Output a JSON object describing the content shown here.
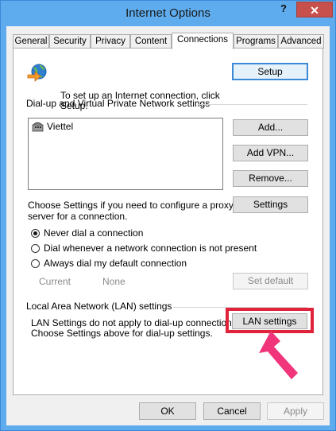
{
  "window": {
    "title": "Internet Options",
    "help_label": "?",
    "close_label": "✕"
  },
  "tabs": [
    "General",
    "Security",
    "Privacy",
    "Content",
    "Connections",
    "Programs",
    "Advanced"
  ],
  "active_tab": "Connections",
  "setup": {
    "text_line1": "To set up an Internet connection, click",
    "text_line2": "Setup.",
    "button": "Setup"
  },
  "dialup": {
    "heading": "Dial-up and Virtual Private Network settings",
    "items": [
      "Viettel"
    ],
    "add_button": "Add...",
    "add_vpn_button": "Add VPN...",
    "remove_button": "Remove...",
    "choose_text_line1": "Choose Settings if you need to configure a proxy",
    "choose_text_line2": "server for a connection.",
    "settings_button": "Settings",
    "options": [
      {
        "label": "Never dial a connection",
        "selected": true
      },
      {
        "label": "Dial whenever a network connection is not present",
        "selected": false
      },
      {
        "label": "Always dial my default connection",
        "selected": false
      }
    ],
    "current_label": "Current",
    "current_value": "None",
    "set_default_button": "Set default"
  },
  "lan": {
    "heading": "Local Area Network (LAN) settings",
    "text_line1": "LAN Settings do not apply to dial-up connections.",
    "text_line2": "Choose Settings above for dial-up settings.",
    "button": "LAN settings",
    "highlight_color": "#e0223a",
    "arrow_color": "#f0357a"
  },
  "footer": {
    "ok": "OK",
    "cancel": "Cancel",
    "apply": "Apply"
  }
}
